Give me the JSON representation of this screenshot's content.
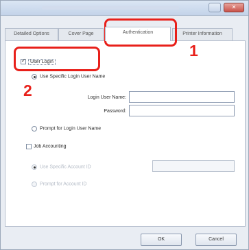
{
  "tabs": [
    {
      "label": "Detailed Options"
    },
    {
      "label": "Cover Page"
    },
    {
      "label": "Authentication"
    },
    {
      "label": "Printer Information"
    }
  ],
  "user_login": {
    "label": "User Login",
    "checked": true
  },
  "specific_login": {
    "label": "Use Specific Login User Name",
    "selected": true
  },
  "login_user_name": {
    "label": "Login User Name:",
    "value": ""
  },
  "password": {
    "label": "Password:",
    "value": ""
  },
  "prompt_login": {
    "label": "Prompt for Login User Name",
    "selected": false
  },
  "job_accounting": {
    "label": "Job Accounting",
    "checked": false
  },
  "specific_account": {
    "label": "Use Specific Account ID",
    "value": ""
  },
  "prompt_account": {
    "label": "Prompt for Account ID"
  },
  "buttons": {
    "ok": "OK",
    "cancel": "Cancel"
  },
  "callouts": {
    "one": "1",
    "two": "2"
  },
  "colors": {
    "callout": "#e8201a",
    "panel": "#ffffff",
    "window": "#e9edf3"
  }
}
